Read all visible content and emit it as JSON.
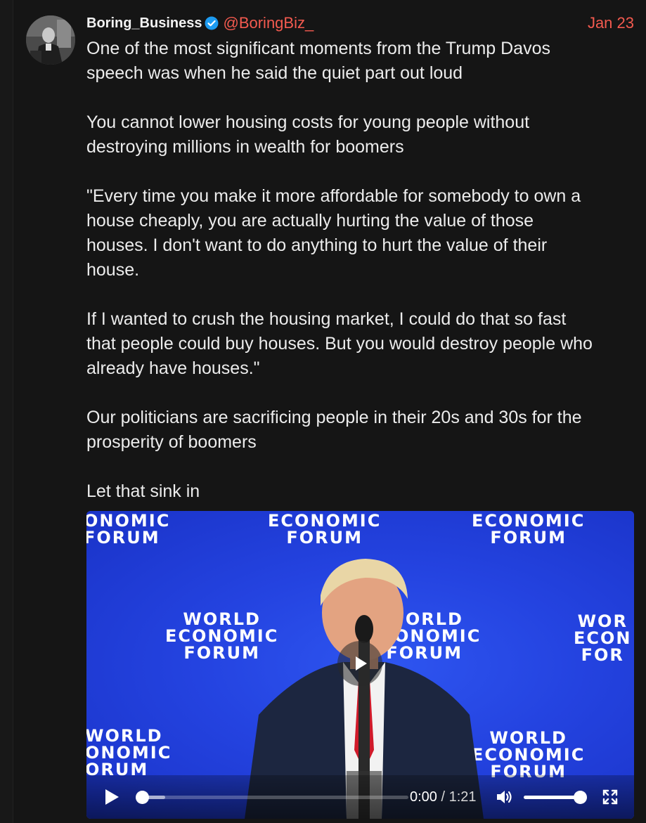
{
  "post": {
    "author_name": "Boring_Business",
    "handle": "@BoringBiz_",
    "date": "Jan 23",
    "verified": true,
    "paragraphs": [
      "One of the most significant moments from the Trump Davos\nspeech was when he said the quiet part out loud",
      "You cannot lower housing costs for young people without\ndestroying millions in wealth for boomers",
      "\"Every time you make it more affordable for somebody to own a\nhouse cheaply, you are actually hurting the value of those\nhouses. I don't want to do anything to hurt the value of their\nhouse.",
      "If I wanted to crush the housing market, I could do that so fast\nthat people could buy houses. But you would destroy people who\nalready have houses.\"",
      "Our politicians are sacrificing people in their 20s and 30s for the\nprosperity of boomers",
      "Let that sink in"
    ]
  },
  "video": {
    "backdrop_text": {
      "economic_forum": "ECONOMIC\nFORUM",
      "world_economic_forum": "WORLD\nECONOMIC\nFORUM",
      "economic_forum_cropped": "ONOMIC\nFORUM",
      "world_economic_forum_cropped_left": "WORLD\nONOMIC\nORUM",
      "world_economic_forum_cropped_right": "WOR\nECON\nFOR"
    },
    "current_time": "0:00",
    "separator": "/",
    "duration": "1:21",
    "progress": 0,
    "volume": 1.0
  },
  "colors": {
    "accent": "#f35a4f",
    "background": "#151515",
    "verified": "#1d9bf0",
    "wef_blue": "#2443e0"
  },
  "icons": {
    "verified": "verified-badge-icon",
    "play_center": "play-icon",
    "play_control": "play-icon",
    "volume": "volume-icon",
    "fullscreen": "fullscreen-icon"
  }
}
